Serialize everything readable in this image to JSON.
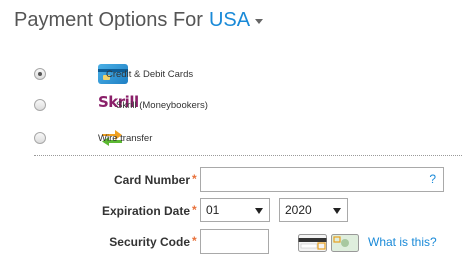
{
  "header": {
    "title": "Payment Options For",
    "country": "USA"
  },
  "payment_options": [
    {
      "label": "Credit & Debit Cards",
      "icon": "credit-card-icon",
      "selected": true
    },
    {
      "brand": "Skrill",
      "label": "Skrill (Moneybookers)",
      "icon": "skrill-logo",
      "selected": false
    },
    {
      "label": "Wire transfer",
      "icon": "wire-transfer-icon",
      "selected": false
    }
  ],
  "form": {
    "card_number": {
      "label": "Card Number",
      "required_mark": "*",
      "value": "",
      "help": "?"
    },
    "expiration": {
      "label": "Expiration Date",
      "required_mark": "*",
      "month": "01",
      "year": "2020"
    },
    "security_code": {
      "label": "Security Code",
      "required_mark": "*",
      "value": "",
      "help_link": "What is this?"
    }
  },
  "colors": {
    "accent": "#1a8ad8",
    "required": "#e8703a",
    "skrill": "#8a1f69"
  }
}
